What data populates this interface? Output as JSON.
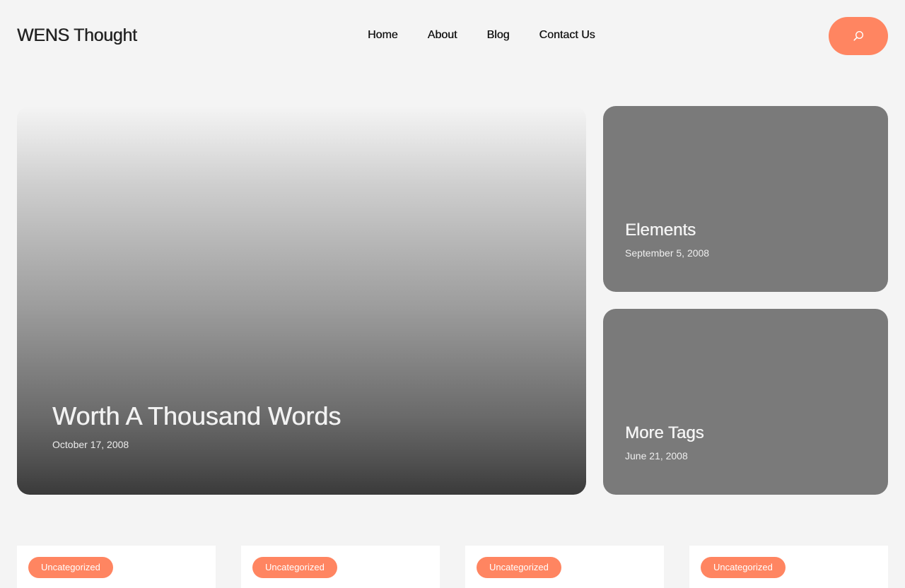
{
  "site": {
    "title": "WENS Thought"
  },
  "nav": {
    "items": [
      {
        "label": "Home"
      },
      {
        "label": "About"
      },
      {
        "label": "Blog"
      },
      {
        "label": "Contact Us"
      }
    ]
  },
  "search": {
    "icon": "search-icon",
    "color": "#ff8561"
  },
  "featured": {
    "title": "Worth A Thousand Words",
    "date": "October 17, 2008"
  },
  "side_posts": [
    {
      "title": "Elements",
      "date": "September 5, 2008"
    },
    {
      "title": "More Tags",
      "date": "June 21, 2008"
    }
  ],
  "post_cards": [
    {
      "category": "Uncategorized"
    },
    {
      "category": "Uncategorized"
    },
    {
      "category": "Uncategorized"
    },
    {
      "category": "Uncategorized"
    }
  ],
  "colors": {
    "accent": "#ff8561",
    "background": "#f4f4f4",
    "card_gray": "#7a7a7a"
  }
}
